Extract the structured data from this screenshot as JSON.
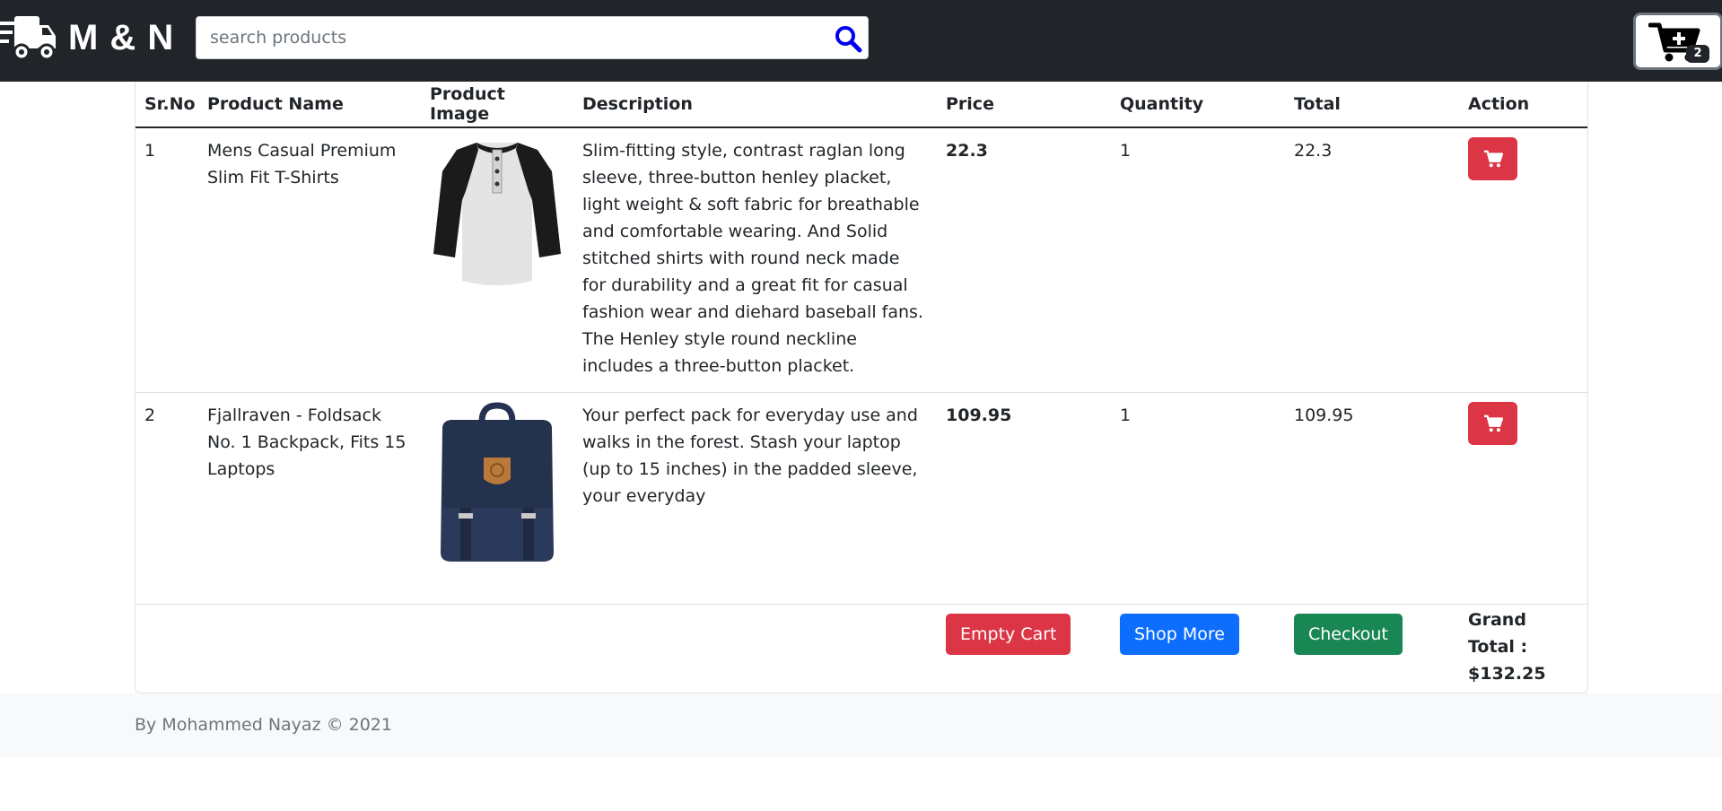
{
  "brand": {
    "name": "M & N",
    "icon": "truck-fast-icon"
  },
  "search": {
    "placeholder": "search products",
    "value": "",
    "icon": "search-icon"
  },
  "cart": {
    "icon": "cart-plus-icon",
    "count": "2"
  },
  "table": {
    "headers": [
      "Sr.No",
      "Product Name",
      "Product Image",
      "Description",
      "Price",
      "Quantity",
      "Total",
      "Action"
    ],
    "rows": [
      {
        "sr": "1",
        "name": "Mens Casual Premium Slim Fit T-Shirts",
        "image": "raglan-henley-tshirt",
        "description": "Slim-fitting style, contrast raglan long sleeve, three-button henley placket, light weight & soft fabric for breathable and comfortable wearing. And Solid stitched shirts with round neck made for durability and a great fit for casual fashion wear and diehard baseball fans. The Henley style round neckline includes a three-button placket.",
        "price": "22.3",
        "quantity": "1",
        "total": "22.3",
        "action_icon": "cart-icon"
      },
      {
        "sr": "2",
        "name": "Fjallraven - Foldsack No. 1 Backpack, Fits 15 Laptops",
        "image": "navy-backpack",
        "description": "Your perfect pack for everyday use and walks in the forest. Stash your laptop (up to 15 inches) in the padded sleeve, your everyday",
        "price": "109.95",
        "quantity": "1",
        "total": "109.95",
        "action_icon": "cart-icon"
      }
    ]
  },
  "actions": {
    "empty_cart": "Empty Cart",
    "shop_more": "Shop More",
    "checkout": "Checkout",
    "grand_total_label": "Grand Total :",
    "grand_total_value": "$132.25"
  },
  "footer": {
    "text": "By Mohammed Nayaz © 2021"
  },
  "colors": {
    "navbar": "#212529",
    "danger": "#dc3545",
    "primary": "#0d6efd",
    "success": "#198754",
    "search_icon": "#0000ee"
  }
}
